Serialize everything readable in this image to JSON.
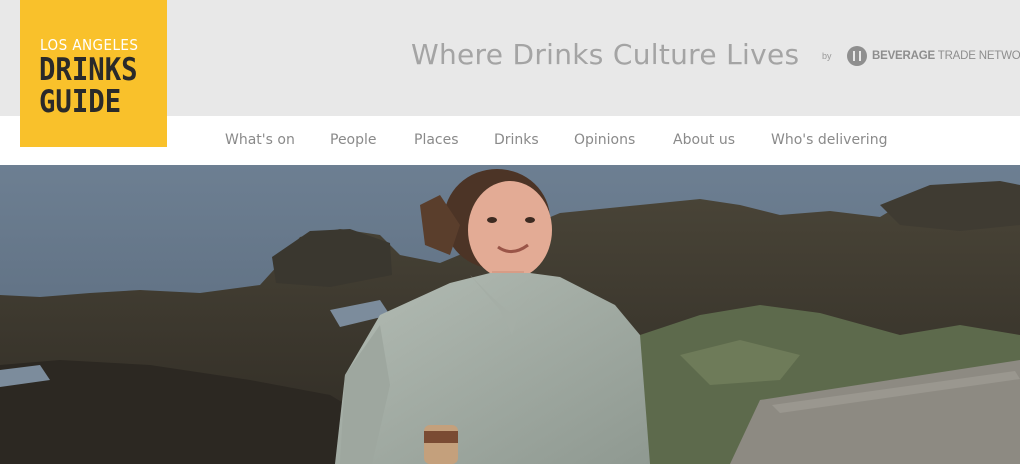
{
  "logo": {
    "line1": "LOS ANGELES",
    "line2": "DRINKS",
    "line3": "GUIDE"
  },
  "header": {
    "tagline": "Where Drinks Culture Lives",
    "by_label": "by",
    "partner_bold": "BEVERAGE",
    "partner_rest": " TRADE NETWORK"
  },
  "nav": {
    "items": [
      "What's on",
      "People",
      "Places",
      "Drinks",
      "Opinions",
      "About us",
      "Who's delivering"
    ]
  },
  "colors": {
    "brand_yellow": "#f9c12b",
    "header_bg": "#e8e8e8",
    "nav_text": "#8a8a8a"
  },
  "hero": {
    "description_alt": ""
  }
}
